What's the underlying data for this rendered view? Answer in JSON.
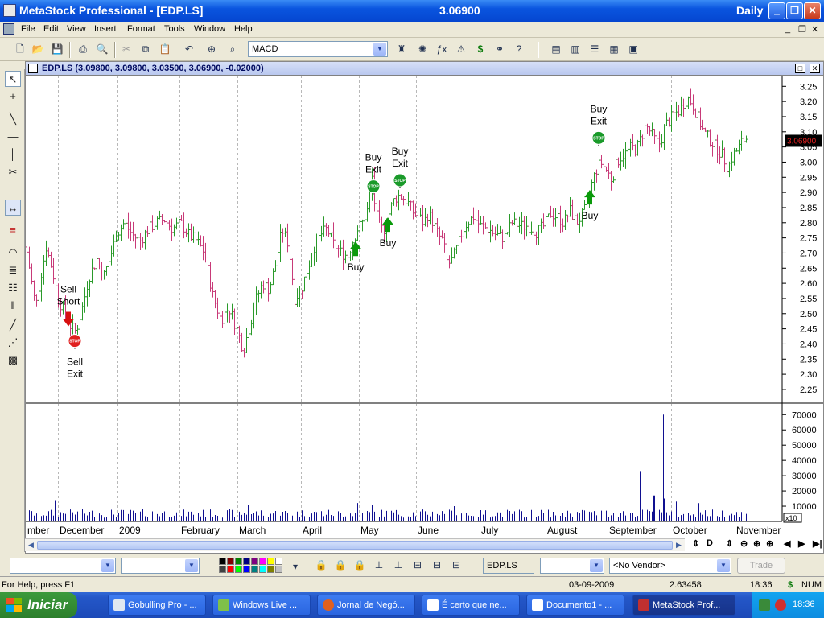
{
  "window": {
    "title": "MetaStock Professional - [EDP.LS]",
    "price": "3.06900",
    "period": "Daily"
  },
  "menu": [
    "File",
    "Edit",
    "View",
    "Insert",
    "Format",
    "Tools",
    "Window",
    "Help"
  ],
  "toolbar": {
    "indicator_value": "MACD"
  },
  "chart_window": {
    "caption": "EDP.LS (3.09800, 3.09800, 3.03500, 3.06900, -0.02000)",
    "last_price_label": "3.06900"
  },
  "chart_data": {
    "type": "bar",
    "price_axis": {
      "ticks": [
        "3.25",
        "3.20",
        "3.15",
        "3.10",
        "3.05",
        "3.00",
        "2.95",
        "2.90",
        "2.85",
        "2.80",
        "2.75",
        "2.70",
        "2.65",
        "2.60",
        "2.55",
        "2.50",
        "2.45",
        "2.40",
        "2.35",
        "2.30",
        "2.25"
      ],
      "ylim": [
        2.21,
        3.28
      ]
    },
    "volume_axis": {
      "ticks": [
        "70000",
        "60000",
        "50000",
        "40000",
        "30000",
        "20000",
        "10000"
      ],
      "ylim": [
        0,
        77000
      ],
      "multiplier": "x10"
    },
    "months": [
      {
        "label": "mber",
        "t": 0
      },
      {
        "label": "December",
        "t": 40
      },
      {
        "label": "2009",
        "t": 114
      },
      {
        "label": "February",
        "t": 191
      },
      {
        "label": "March",
        "t": 263
      },
      {
        "label": "April",
        "t": 342
      },
      {
        "label": "May",
        "t": 414
      },
      {
        "label": "June",
        "t": 485
      },
      {
        "label": "July",
        "t": 564
      },
      {
        "label": "August",
        "t": 646
      },
      {
        "label": "September",
        "t": 723
      },
      {
        "label": "October",
        "t": 802
      },
      {
        "label": "November",
        "t": 881
      }
    ],
    "price_anchors": [
      [
        0,
        2.72
      ],
      [
        6,
        2.62
      ],
      [
        12,
        2.52
      ],
      [
        18,
        2.62
      ],
      [
        25,
        2.72
      ],
      [
        32,
        2.65
      ],
      [
        40,
        2.55
      ],
      [
        48,
        2.5
      ],
      [
        55,
        2.46
      ],
      [
        62,
        2.44
      ],
      [
        70,
        2.52
      ],
      [
        78,
        2.62
      ],
      [
        88,
        2.68
      ],
      [
        96,
        2.62
      ],
      [
        104,
        2.68
      ],
      [
        112,
        2.76
      ],
      [
        122,
        2.8
      ],
      [
        132,
        2.76
      ],
      [
        142,
        2.74
      ],
      [
        152,
        2.78
      ],
      [
        162,
        2.8
      ],
      [
        172,
        2.81
      ],
      [
        182,
        2.78
      ],
      [
        192,
        2.8
      ],
      [
        202,
        2.76
      ],
      [
        212,
        2.74
      ],
      [
        222,
        2.7
      ],
      [
        232,
        2.56
      ],
      [
        242,
        2.48
      ],
      [
        252,
        2.52
      ],
      [
        262,
        2.45
      ],
      [
        270,
        2.38
      ],
      [
        278,
        2.46
      ],
      [
        286,
        2.55
      ],
      [
        294,
        2.6
      ],
      [
        302,
        2.58
      ],
      [
        310,
        2.66
      ],
      [
        318,
        2.78
      ],
      [
        326,
        2.73
      ],
      [
        334,
        2.55
      ],
      [
        342,
        2.58
      ],
      [
        350,
        2.65
      ],
      [
        358,
        2.72
      ],
      [
        366,
        2.76
      ],
      [
        374,
        2.78
      ],
      [
        382,
        2.73
      ],
      [
        392,
        2.7
      ],
      [
        400,
        2.69
      ],
      [
        406,
        2.74
      ],
      [
        412,
        2.78
      ],
      [
        418,
        2.8
      ],
      [
        424,
        2.84
      ],
      [
        430,
        2.95
      ],
      [
        434,
        2.84
      ],
      [
        440,
        2.78
      ],
      [
        446,
        2.78
      ],
      [
        452,
        2.84
      ],
      [
        458,
        2.88
      ],
      [
        464,
        2.89
      ],
      [
        470,
        2.88
      ],
      [
        476,
        2.86
      ],
      [
        482,
        2.83
      ],
      [
        488,
        2.82
      ],
      [
        494,
        2.8
      ],
      [
        500,
        2.83
      ],
      [
        506,
        2.8
      ],
      [
        512,
        2.76
      ],
      [
        518,
        2.74
      ],
      [
        524,
        2.66
      ],
      [
        530,
        2.68
      ],
      [
        536,
        2.72
      ],
      [
        542,
        2.77
      ],
      [
        548,
        2.8
      ],
      [
        556,
        2.82
      ],
      [
        564,
        2.79
      ],
      [
        574,
        2.78
      ],
      [
        584,
        2.76
      ],
      [
        594,
        2.75
      ],
      [
        604,
        2.8
      ],
      [
        614,
        2.79
      ],
      [
        624,
        2.79
      ],
      [
        634,
        2.77
      ],
      [
        644,
        2.79
      ],
      [
        652,
        2.83
      ],
      [
        660,
        2.82
      ],
      [
        668,
        2.8
      ],
      [
        676,
        2.84
      ],
      [
        684,
        2.8
      ],
      [
        690,
        2.82
      ],
      [
        696,
        2.85
      ],
      [
        702,
        2.92
      ],
      [
        708,
        2.97
      ],
      [
        714,
        3.0
      ],
      [
        722,
        2.97
      ],
      [
        728,
        2.94
      ],
      [
        734,
        3.0
      ],
      [
        740,
        3.02
      ],
      [
        746,
        3.03
      ],
      [
        752,
        3.05
      ],
      [
        758,
        3.04
      ],
      [
        764,
        3.08
      ],
      [
        770,
        3.12
      ],
      [
        776,
        3.1
      ],
      [
        782,
        3.07
      ],
      [
        788,
        3.06
      ],
      [
        794,
        3.12
      ],
      [
        800,
        3.14
      ],
      [
        806,
        3.16
      ],
      [
        812,
        3.17
      ],
      [
        818,
        3.2
      ],
      [
        824,
        3.21
      ],
      [
        830,
        3.18
      ],
      [
        836,
        3.14
      ],
      [
        842,
        3.1
      ],
      [
        848,
        3.08
      ],
      [
        854,
        3.06
      ],
      [
        860,
        3.04
      ],
      [
        866,
        3.02
      ],
      [
        872,
        2.98
      ],
      [
        878,
        3.02
      ],
      [
        884,
        3.04
      ],
      [
        890,
        3.07
      ],
      [
        896,
        3.08
      ]
    ],
    "volume_spikes": [
      [
        764,
        33000
      ],
      [
        792,
        70000
      ],
      [
        794,
        15000
      ],
      [
        780,
        17000
      ],
      [
        412,
        12000
      ],
      [
        430,
        11000
      ],
      [
        532,
        10000
      ],
      [
        36,
        14000
      ],
      [
        276,
        11000
      ],
      [
        808,
        13000
      ],
      [
        836,
        12000
      ]
    ],
    "signals": [
      {
        "type": "sell",
        "t": 53,
        "price": 2.49,
        "label1": "Sell",
        "label2": "Short"
      },
      {
        "type": "exit",
        "color": "red",
        "t": 61,
        "price": 2.41,
        "label1": "Sell",
        "label2": "Exit"
      },
      {
        "type": "buy",
        "t": 410,
        "price": 2.69,
        "label1": "Buy",
        "label2": ""
      },
      {
        "type": "exit",
        "color": "green",
        "t": 432,
        "price": 2.92,
        "label1": "Buy",
        "label2": "Exit"
      },
      {
        "type": "buy",
        "t": 450,
        "price": 2.77,
        "label1": "Buy",
        "label2": ""
      },
      {
        "type": "exit",
        "color": "green",
        "t": 465,
        "price": 2.94,
        "label1": "Buy",
        "label2": "Exit"
      },
      {
        "type": "buy",
        "t": 701,
        "price": 2.86,
        "label1": "Buy",
        "label2": ""
      },
      {
        "type": "exit",
        "color": "green",
        "t": 712,
        "price": 3.08,
        "label1": "Buy",
        "label2": "Exit"
      }
    ],
    "exit_sign_text": "STOP",
    "colors": {
      "up": "#2a9a2a",
      "down": "#c83a78",
      "volume": "#101090",
      "grid": "#b8b8b8",
      "exit_red": "#e02020",
      "exit_green": "#1a9a2a",
      "buy_arrow": "#0a9a0a",
      "sell_arrow": "#d81010"
    }
  },
  "bottom": {
    "symbol": "EDP.LS",
    "vendor": "<No Vendor>",
    "trade": "Trade"
  },
  "status": {
    "help": "For Help, press F1",
    "date": "03-09-2009",
    "value": "2.63458",
    "time": "18:36",
    "num": "NUM"
  },
  "taskbar": {
    "start": "Iniciar",
    "tasks": [
      "Gobulling Pro - ...",
      "Windows Live ...",
      "Jornal de Negó...",
      "É certo que ne...",
      "Documento1 - ...",
      "MetaStock Prof..."
    ],
    "clock": "18:36"
  }
}
